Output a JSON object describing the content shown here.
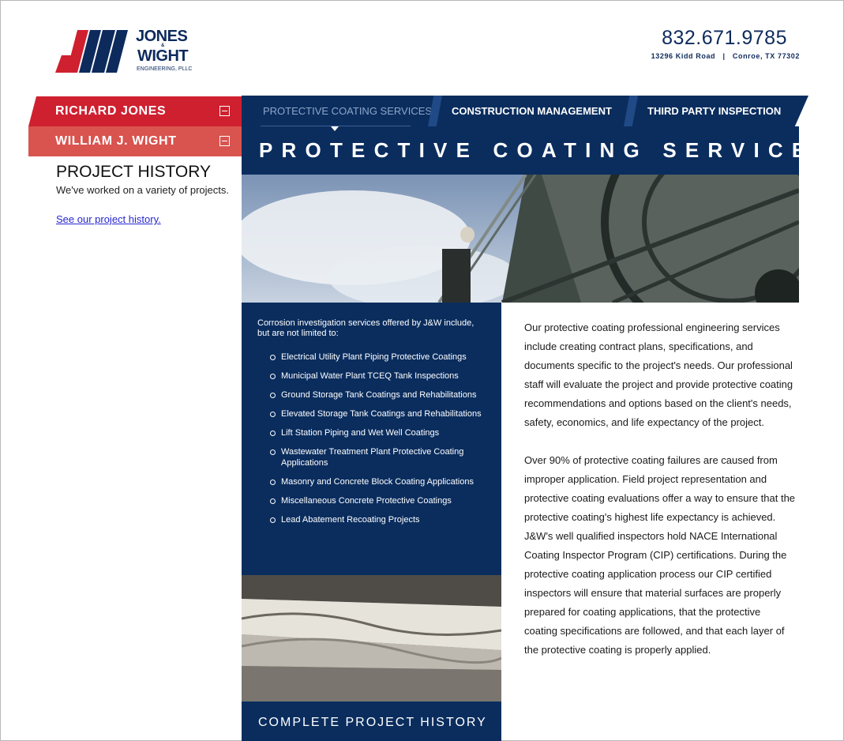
{
  "header": {
    "logo_jones": "JONES",
    "logo_amp": "&",
    "logo_wight": "WIGHT",
    "logo_sub": "ENGINEERING, PLLC",
    "phone": "832.671.9785",
    "address": "13296 Kidd Road   |   Conroe, TX 77302"
  },
  "sidebar": {
    "people": [
      {
        "label": "RICHARD JONES"
      },
      {
        "label": "WILLIAM J. WIGHT"
      }
    ],
    "project_history": {
      "title": "PROJECT HISTORY",
      "text": "We've worked on a variety of projects.",
      "link": "See our project history."
    }
  },
  "nav": {
    "tabs": [
      {
        "label": "PROTECTIVE COATING SERVICES",
        "active": true
      },
      {
        "label": "CONSTRUCTION MANAGEMENT",
        "active": false
      },
      {
        "label": "THIRD PARTY INSPECTION",
        "active": false
      }
    ]
  },
  "main": {
    "title": "PROTECTIVE COATING SERVICES",
    "services_intro": "Corrosion investigation services offered by J&W include, but are not limited to:",
    "services": [
      "Electrical Utility Plant Piping Protective Coatings",
      "Municipal Water Plant TCEQ Tank Inspections",
      "Ground Storage Tank Coatings and Rehabilitations",
      "Elevated Storage Tank Coatings and Rehabilitations",
      "Lift Station Piping and Wet Well Coatings",
      "Wastewater Treatment Plant Protective Coating Applications",
      "Masonry and Concrete Block Coating Applications",
      "Miscellaneous Concrete Protective Coatings",
      "Lead Abatement Recoating Projects"
    ],
    "complete_history": "COMPLETE PROJECT HISTORY",
    "paragraphs": [
      "Our protective coating professional engineering services include creating contract plans, specifications, and documents specific to the project's needs. Our professional staff will evaluate the project and provide protective coating recommendations and options based on the client's needs, safety, economics, and life expectancy of the project.",
      "Over 90% of protective coating failures are caused from improper application. Field project representation and protective coating evaluations offer a way to ensure that the protective coating's highest life expectancy is achieved. J&W's well qualified inspectors hold NACE International Coating Inspector Program (CIP) certifications. During the protective coating application process our CIP certified inspectors will ensure that material surfaces are properly prepared for coating applications, that the protective coating specifications are followed, and that each layer of the protective coating is properly applied."
    ]
  },
  "colors": {
    "navy": "#0a2d5e",
    "red": "#cf2030",
    "salmon": "#d9534f",
    "link": "#2727d0"
  }
}
